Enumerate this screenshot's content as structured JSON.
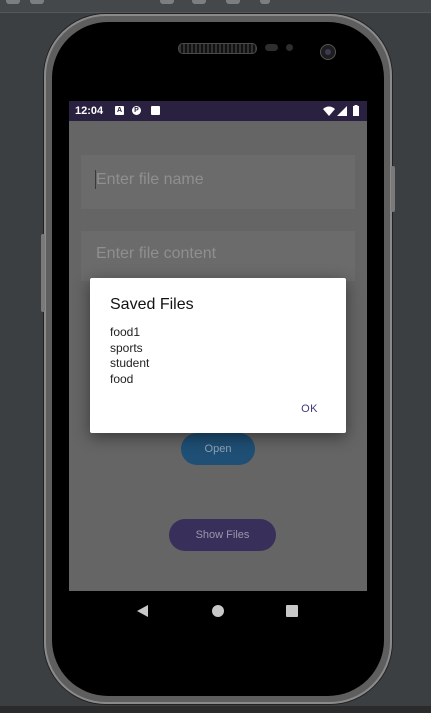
{
  "status_bar": {
    "time": "12:04"
  },
  "form": {
    "file_name_placeholder": "Enter file name",
    "file_content_placeholder": "Enter file content",
    "open_label": "Open",
    "show_files_label": "Show Files"
  },
  "dialog": {
    "title": "Saved Files",
    "files": [
      "food1",
      "sports",
      "student",
      "food"
    ],
    "ok_label": "OK"
  },
  "colors": {
    "status_bar": "#2a2140",
    "dialog_button": "#3f3a78",
    "open_button": "#1f4f75",
    "show_files_button": "#38305a"
  }
}
